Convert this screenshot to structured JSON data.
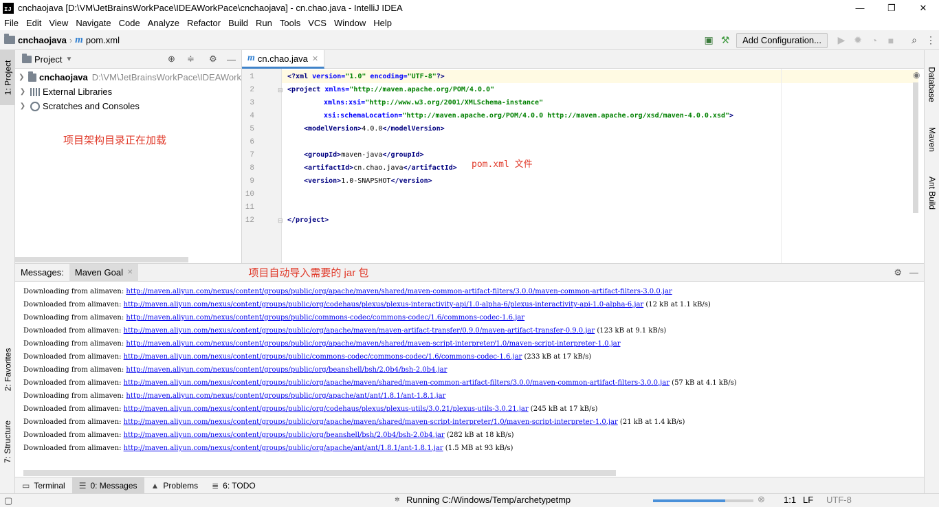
{
  "window": {
    "title": "cnchaojava [D:\\VM\\JetBrainsWorkPace\\IDEAWorkPace\\cnchaojava] - cn.chao.java - IntelliJ IDEA",
    "icon_text": "IJ",
    "min": "—",
    "max": "❐",
    "close": "✕"
  },
  "menu": [
    "File",
    "Edit",
    "View",
    "Navigate",
    "Code",
    "Analyze",
    "Refactor",
    "Build",
    "Run",
    "Tools",
    "VCS",
    "Window",
    "Help"
  ],
  "navbar": {
    "project": "cnchaojava",
    "file": "pom.xml",
    "file_icon": "m",
    "add_config": "Add Configuration..."
  },
  "left_strip": {
    "project_tab": "1: Project",
    "favorites_tab": "2: Favorites",
    "structure_tab": "7: Structure"
  },
  "right_strip": {
    "database_tab": "Database",
    "maven_tab": "Maven",
    "ant_tab": "Ant Build"
  },
  "project_panel": {
    "title": "Project",
    "items": [
      {
        "name": "cnchaojava",
        "path": "D:\\VM\\JetBrainsWorkPace\\IDEAWork"
      },
      {
        "name": "External Libraries"
      },
      {
        "name": "Scratches and Consoles"
      }
    ],
    "annotation": "项目架构目录正在加载"
  },
  "editor": {
    "tab": "cn.chao.java",
    "line_numbers": [
      "1",
      "2",
      "3",
      "4",
      "5",
      "6",
      "7",
      "8",
      "9",
      "10",
      "11",
      "12"
    ],
    "annotation": "pom.xml 文件"
  },
  "messages": {
    "label": "Messages:",
    "tab": "Maven Goal",
    "annotation": "项目自动导入需要的 jar 包",
    "lines": [
      {
        "prefix": "Downloading from alimaven: ",
        "url": "http://maven.aliyun.com/nexus/content/groups/public/org/apache/maven/shared/maven-common-artifact-filters/3.0.0/maven-common-artifact-filters-3.0.0.jar",
        "suffix": ""
      },
      {
        "prefix": "Downloaded from alimaven: ",
        "url": "http://maven.aliyun.com/nexus/content/groups/public/org/codehaus/plexus/plexus-interactivity-api/1.0-alpha-6/plexus-interactivity-api-1.0-alpha-6.jar",
        "suffix": " (12 kB at 1.1 kB/s)"
      },
      {
        "prefix": "Downloading from alimaven: ",
        "url": "http://maven.aliyun.com/nexus/content/groups/public/commons-codec/commons-codec/1.6/commons-codec-1.6.jar",
        "suffix": ""
      },
      {
        "prefix": "Downloaded from alimaven: ",
        "url": "http://maven.aliyun.com/nexus/content/groups/public/org/apache/maven/maven-artifact-transfer/0.9.0/maven-artifact-transfer-0.9.0.jar",
        "suffix": " (123 kB at 9.1 kB/s)"
      },
      {
        "prefix": "Downloading from alimaven: ",
        "url": "http://maven.aliyun.com/nexus/content/groups/public/org/apache/maven/shared/maven-script-interpreter/1.0/maven-script-interpreter-1.0.jar",
        "suffix": ""
      },
      {
        "prefix": "Downloaded from alimaven: ",
        "url": "http://maven.aliyun.com/nexus/content/groups/public/commons-codec/commons-codec/1.6/commons-codec-1.6.jar",
        "suffix": " (233 kB at 17 kB/s)"
      },
      {
        "prefix": "Downloading from alimaven: ",
        "url": "http://maven.aliyun.com/nexus/content/groups/public/org/beanshell/bsh/2.0b4/bsh-2.0b4.jar",
        "suffix": ""
      },
      {
        "prefix": "Downloaded from alimaven: ",
        "url": "http://maven.aliyun.com/nexus/content/groups/public/org/apache/maven/shared/maven-common-artifact-filters/3.0.0/maven-common-artifact-filters-3.0.0.jar",
        "suffix": " (57 kB at 4.1 kB/s)"
      },
      {
        "prefix": "Downloading from alimaven: ",
        "url": "http://maven.aliyun.com/nexus/content/groups/public/org/apache/ant/ant/1.8.1/ant-1.8.1.jar",
        "suffix": ""
      },
      {
        "prefix": "Downloaded from alimaven: ",
        "url": "http://maven.aliyun.com/nexus/content/groups/public/org/codehaus/plexus/plexus-utils/3.0.21/plexus-utils-3.0.21.jar",
        "suffix": " (245 kB at 17 kB/s)"
      },
      {
        "prefix": "Downloaded from alimaven: ",
        "url": "http://maven.aliyun.com/nexus/content/groups/public/org/apache/maven/shared/maven-script-interpreter/1.0/maven-script-interpreter-1.0.jar",
        "suffix": " (21 kB at 1.4 kB/s)"
      },
      {
        "prefix": "Downloaded from alimaven: ",
        "url": "http://maven.aliyun.com/nexus/content/groups/public/org/beanshell/bsh/2.0b4/bsh-2.0b4.jar",
        "suffix": " (282 kB at 18 kB/s)"
      },
      {
        "prefix": "Downloaded from alimaven: ",
        "url": "http://maven.aliyun.com/nexus/content/groups/public/org/apache/ant/ant/1.8.1/ant-1.8.1.jar",
        "suffix": " (1.5 MB at 93 kB/s)"
      }
    ]
  },
  "bottom_tabs": [
    {
      "label": "Terminal"
    },
    {
      "label": "0: Messages"
    },
    {
      "label": "Problems"
    },
    {
      "label": "6: TODO"
    }
  ],
  "status": {
    "running": "Running C:/Windows/Temp/archetypetmp",
    "position": "1:1",
    "line_sep": "LF",
    "encoding": "UTF-8",
    "progress": 0.72
  }
}
